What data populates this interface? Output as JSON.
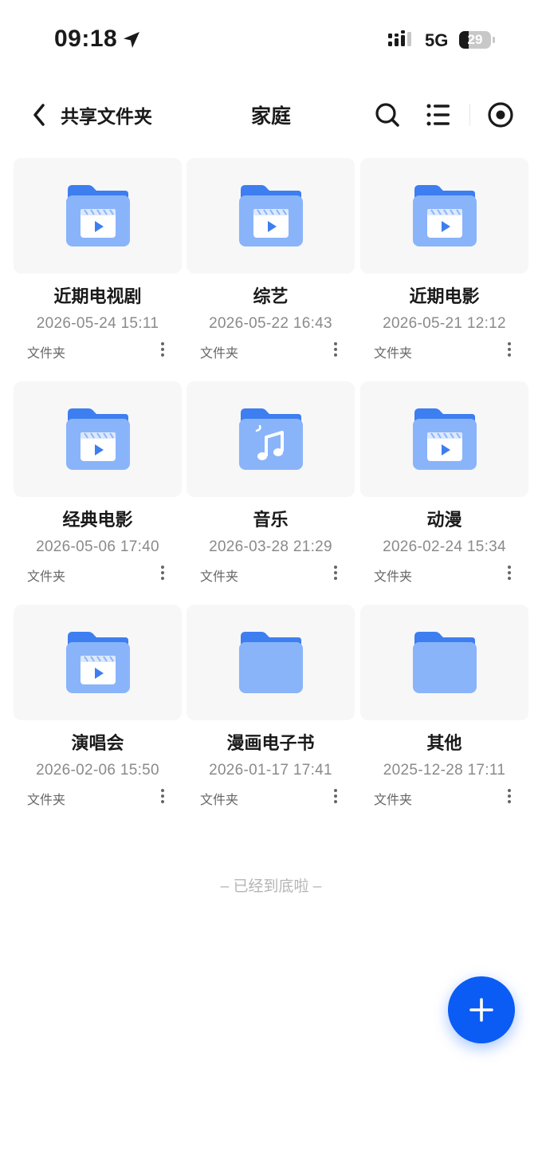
{
  "status_bar": {
    "time": "09:18",
    "network": "5G",
    "battery": "29",
    "battery_level": 0.29
  },
  "nav": {
    "back_label": "共享文件夹",
    "title": "家庭"
  },
  "folders": [
    {
      "name": "近期电视剧",
      "date": "2026-05-24 15:11",
      "type": "文件夹",
      "icon": "video-folder-icon"
    },
    {
      "name": "综艺",
      "date": "2026-05-22 16:43",
      "type": "文件夹",
      "icon": "video-folder-icon"
    },
    {
      "name": "近期电影",
      "date": "2026-05-21 12:12",
      "type": "文件夹",
      "icon": "video-folder-icon"
    },
    {
      "name": "经典电影",
      "date": "2026-05-06 17:40",
      "type": "文件夹",
      "icon": "video-folder-icon"
    },
    {
      "name": "音乐",
      "date": "2026-03-28 21:29",
      "type": "文件夹",
      "icon": "music-folder-icon"
    },
    {
      "name": "动漫",
      "date": "2026-02-24 15:34",
      "type": "文件夹",
      "icon": "video-folder-icon"
    },
    {
      "name": "演唱会",
      "date": "2026-02-06 15:50",
      "type": "文件夹",
      "icon": "video-folder-icon"
    },
    {
      "name": "漫画电子书",
      "date": "2026-01-17 17:41",
      "type": "文件夹",
      "icon": "folder-icon"
    },
    {
      "name": "其他",
      "date": "2025-12-28 17:11",
      "type": "文件夹",
      "icon": "folder-icon"
    }
  ],
  "footer_note": "– 已经到底啦 –",
  "colors": {
    "accent": "#0a5cf5",
    "folder_back": "#3d7ef0",
    "folder_front": "#8ab4fa"
  }
}
